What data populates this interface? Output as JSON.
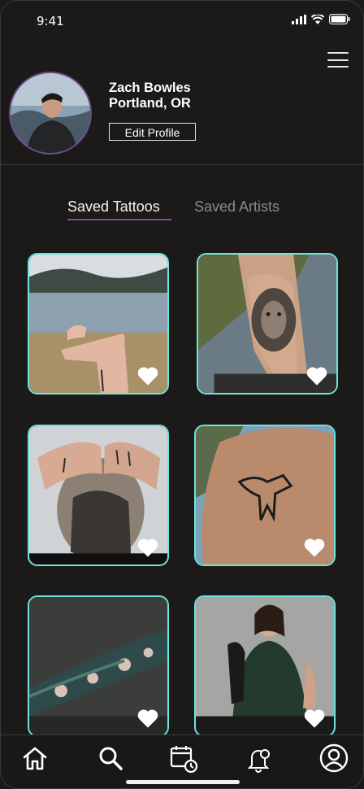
{
  "status_bar": {
    "time": "9:41"
  },
  "profile": {
    "name": "Zach Bowles",
    "location": "Portland, OR",
    "edit_label": "Edit Profile"
  },
  "tabs": [
    {
      "label": "Saved Tattoos",
      "active": true
    },
    {
      "label": "Saved Artists",
      "active": false
    }
  ],
  "saved_tattoos": [
    {
      "subject": "wrist tattoo by a lake",
      "favorited": true
    },
    {
      "subject": "lion forearm tattoo",
      "favorited": true
    },
    {
      "subject": "head and hand tattoos",
      "favorited": true
    },
    {
      "subject": "hummingbird arm tattoo",
      "favorited": true
    },
    {
      "subject": "floral sleeve tattoo",
      "favorited": true
    },
    {
      "subject": "tattoo artist portrait",
      "favorited": true
    }
  ],
  "nav": [
    "home-icon",
    "search-icon",
    "calendar-icon",
    "bell-icon",
    "profile-icon"
  ],
  "colors": {
    "background": "#1c1a19",
    "card_border": "#6fe3dd",
    "accent": "#7a4f95"
  }
}
